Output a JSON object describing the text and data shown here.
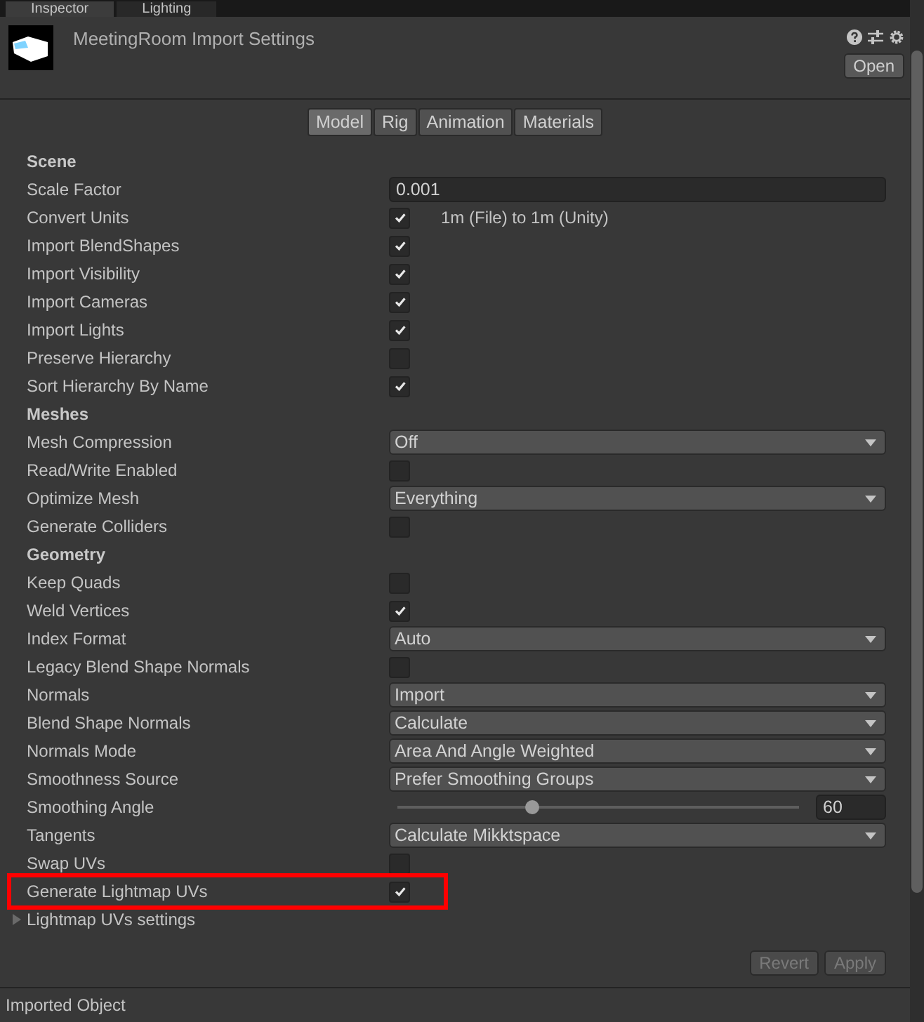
{
  "window_tabs": [
    {
      "label": "Inspector",
      "selected": true
    },
    {
      "label": "Lighting",
      "selected": false
    }
  ],
  "header": {
    "title": "MeetingRoom Import Settings",
    "open_button": "Open"
  },
  "tabs": [
    {
      "label": "Model",
      "selected": true
    },
    {
      "label": "Rig",
      "selected": false
    },
    {
      "label": "Animation",
      "selected": false
    },
    {
      "label": "Materials",
      "selected": false
    }
  ],
  "rows": [
    {
      "kind": "header",
      "label": "Scene"
    },
    {
      "kind": "field",
      "label": "Scale Factor",
      "value": "0.001"
    },
    {
      "kind": "check",
      "label": "Convert Units",
      "checked": true,
      "note": "1m (File) to 1m (Unity)"
    },
    {
      "kind": "check",
      "label": "Import BlendShapes",
      "checked": true
    },
    {
      "kind": "check",
      "label": "Import Visibility",
      "checked": true
    },
    {
      "kind": "check",
      "label": "Import Cameras",
      "checked": true
    },
    {
      "kind": "check",
      "label": "Import Lights",
      "checked": true
    },
    {
      "kind": "check",
      "label": "Preserve Hierarchy",
      "checked": false
    },
    {
      "kind": "check",
      "label": "Sort Hierarchy By Name",
      "checked": true
    },
    {
      "kind": "header",
      "label": "Meshes"
    },
    {
      "kind": "dropdown",
      "label": "Mesh Compression",
      "value": "Off"
    },
    {
      "kind": "check",
      "label": "Read/Write Enabled",
      "checked": false
    },
    {
      "kind": "dropdown",
      "label": "Optimize Mesh",
      "value": "Everything"
    },
    {
      "kind": "check",
      "label": "Generate Colliders",
      "checked": false
    },
    {
      "kind": "header",
      "label": "Geometry"
    },
    {
      "kind": "check",
      "label": "Keep Quads",
      "checked": false
    },
    {
      "kind": "check",
      "label": "Weld Vertices",
      "checked": true
    },
    {
      "kind": "dropdown",
      "label": "Index Format",
      "value": "Auto"
    },
    {
      "kind": "check",
      "label": "Legacy Blend Shape Normals",
      "checked": false
    },
    {
      "kind": "dropdown",
      "label": "Normals",
      "value": "Import"
    },
    {
      "kind": "dropdown",
      "label": "Blend Shape Normals",
      "value": "Calculate"
    },
    {
      "kind": "dropdown",
      "label": "Normals Mode",
      "value": "Area And Angle Weighted"
    },
    {
      "kind": "dropdown",
      "label": "Smoothness Source",
      "value": "Prefer Smoothing Groups"
    },
    {
      "kind": "slider",
      "label": "Smoothing Angle",
      "level": 0.335,
      "value": "60"
    },
    {
      "kind": "dropdown",
      "label": "Tangents",
      "value": "Calculate Mikktspace"
    },
    {
      "kind": "check",
      "label": "Swap UVs",
      "checked": false
    },
    {
      "kind": "check",
      "label": "Generate Lightmap UVs",
      "checked": true,
      "highlighted": true
    },
    {
      "kind": "foldout",
      "label": "Lightmap UVs settings",
      "expanded": false
    }
  ],
  "buttons": [
    {
      "label": "Revert",
      "disabled": true
    },
    {
      "label": "Apply",
      "disabled": true
    }
  ],
  "status_bar": "Imported Object"
}
